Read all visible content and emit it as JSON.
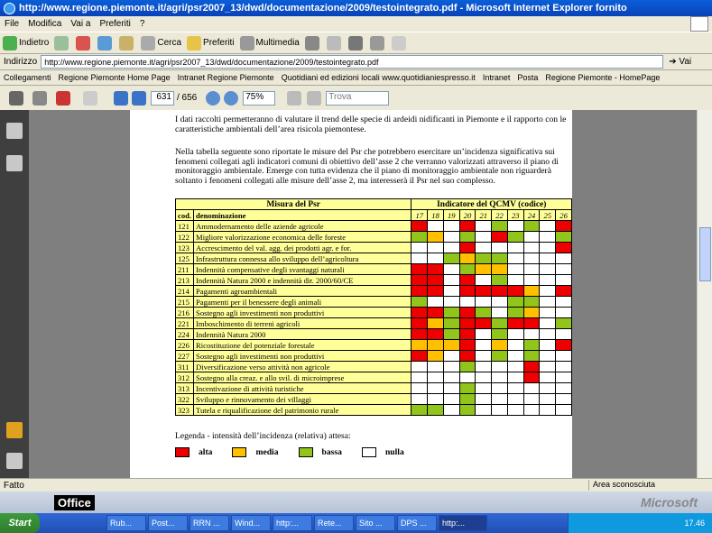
{
  "window": {
    "title": "http://www.regione.piemonte.it/agri/psr2007_13/dwd/documentazione/2009/testointegrato.pdf - Microsoft Internet Explorer fornito"
  },
  "menu": [
    "File",
    "Modifica",
    "Vai a",
    "Preferiti",
    "?"
  ],
  "toolbar": {
    "back": "Indietro",
    "search": "Cerca",
    "favorites": "Preferiti",
    "multimedia": "Multimedia"
  },
  "address": {
    "label": "Indirizzo",
    "url": "http://www.regione.piemonte.it/agri/psr2007_13/dwd/documentazione/2009/testointegrato.pdf",
    "go": "Vai"
  },
  "links": [
    "Collegamenti",
    "Regione Piemonte Home Page",
    "Intranet Regione Piemonte",
    "Quotidiani ed edizioni locali www.quotidianiespresso.it",
    "Intranet",
    "Posta",
    "Regione Piemonte - HomePage"
  ],
  "pdf": {
    "page": "631",
    "total": "/ 656",
    "zoom": "75%",
    "find_placeholder": "Trova"
  },
  "doc": {
    "p1": "I dati raccolti permetteranno di valutare il trend delle specie di ardeidi nidificanti in Piemonte e il rapporto con le caratteristiche ambientali dell’area risicola piemontese.",
    "p2": "Nella tabella seguente sono riportate le misure del Psr che potrebbero esercitare un’incidenza significativa sui fenomeni collegati agli indicatori comuni di obiettivo dell’asse 2 che verranno valorizzati attraverso il piano di monitoraggio ambientale. Emerge con tutta evidenza che il piano di monitoraggio ambientale non riguarderà soltanto i fenomeni collegati alle misure dell’asse 2, ma interesserà il Psr nel suo complesso.",
    "table": {
      "h_misura": "Misura del Psr",
      "h_indicatore": "Indicatore del QCMV (codice)",
      "h_cod": "cod.",
      "h_den": "denominazione",
      "indicators": [
        "17",
        "18",
        "19",
        "20",
        "21",
        "22",
        "23",
        "24",
        "25",
        "26"
      ],
      "rows": [
        {
          "cod": "121",
          "den": "Ammodernamento delle aziende agricole",
          "cells": [
            "r",
            "w",
            "w",
            "r",
            "w",
            "g",
            "w",
            "g",
            "w",
            "r"
          ]
        },
        {
          "cod": "122",
          "den": "Migliore valorizzazione economica delle foreste",
          "cells": [
            "g",
            "y",
            "w",
            "g",
            "w",
            "r",
            "g",
            "w",
            "w",
            "g"
          ]
        },
        {
          "cod": "123",
          "den": "Accrescimento del val. agg. dei prodotti agr. e for.",
          "cells": [
            "w",
            "w",
            "w",
            "r",
            "w",
            "w",
            "w",
            "w",
            "w",
            "r"
          ]
        },
        {
          "cod": "125",
          "den": "Infrastruttura connessa allo sviluppo dell’agricoltura",
          "cells": [
            "w",
            "w",
            "g",
            "y",
            "g",
            "g",
            "w",
            "w",
            "w",
            "w"
          ]
        },
        {
          "cod": "211",
          "den": "Indennità compensative degli svantaggi naturali",
          "cells": [
            "r",
            "r",
            "w",
            "g",
            "y",
            "y",
            "w",
            "w",
            "w",
            "w"
          ]
        },
        {
          "cod": "213",
          "den": "Indennità Natura 2000 e indennità dir. 2000/60/CE",
          "cells": [
            "r",
            "r",
            "w",
            "r",
            "w",
            "g",
            "w",
            "w",
            "w",
            "w"
          ]
        },
        {
          "cod": "214",
          "den": "Pagamenti agroambientali",
          "cells": [
            "r",
            "r",
            "w",
            "r",
            "r",
            "r",
            "r",
            "y",
            "w",
            "r"
          ]
        },
        {
          "cod": "215",
          "den": "Pagamenti per il benessere degli animali",
          "cells": [
            "g",
            "w",
            "w",
            "w",
            "w",
            "w",
            "g",
            "g",
            "w",
            "w"
          ]
        },
        {
          "cod": "216",
          "den": "Sostegno agli investimenti non produttivi",
          "cells": [
            "r",
            "r",
            "g",
            "r",
            "g",
            "w",
            "g",
            "y",
            "w",
            "w"
          ]
        },
        {
          "cod": "221",
          "den": "Imboschimento di terreni agricoli",
          "cells": [
            "r",
            "y",
            "g",
            "r",
            "r",
            "g",
            "r",
            "r",
            "w",
            "g"
          ]
        },
        {
          "cod": "224",
          "den": "Indennità Natura 2000",
          "cells": [
            "r",
            "r",
            "g",
            "r",
            "w",
            "g",
            "w",
            "w",
            "w",
            "w"
          ]
        },
        {
          "cod": "226",
          "den": "Ricostituzione del potenziale forestale",
          "cells": [
            "y",
            "y",
            "y",
            "r",
            "w",
            "y",
            "w",
            "g",
            "w",
            "r"
          ]
        },
        {
          "cod": "227",
          "den": "Sostegno agli investimenti non produttivi",
          "cells": [
            "r",
            "y",
            "w",
            "r",
            "w",
            "g",
            "w",
            "g",
            "w",
            "w"
          ]
        },
        {
          "cod": "311",
          "den": "Diversificazione verso attività non agricole",
          "cells": [
            "w",
            "w",
            "w",
            "g",
            "w",
            "w",
            "w",
            "r",
            "w",
            "w"
          ]
        },
        {
          "cod": "312",
          "den": "Sostegno alla creaz. e allo svil. di microimprese",
          "cells": [
            "w",
            "w",
            "w",
            "w",
            "w",
            "w",
            "w",
            "r",
            "w",
            "w"
          ]
        },
        {
          "cod": "313",
          "den": "Incentivazione di attività turistiche",
          "cells": [
            "w",
            "w",
            "w",
            "g",
            "w",
            "w",
            "w",
            "w",
            "w",
            "w"
          ]
        },
        {
          "cod": "322",
          "den": "Sviluppo e rinnovamento dei villaggi",
          "cells": [
            "w",
            "w",
            "w",
            "g",
            "w",
            "w",
            "w",
            "w",
            "w",
            "w"
          ]
        },
        {
          "cod": "323",
          "den": "Tutela e riqualificazione del patrimonio rurale",
          "cells": [
            "g",
            "g",
            "w",
            "g",
            "w",
            "w",
            "w",
            "w",
            "w",
            "w"
          ]
        }
      ]
    },
    "legend_title": "Legenda - intensità dell’incidenza (relativa) attesa:",
    "legend": [
      {
        "k": "r",
        "label": "alta"
      },
      {
        "k": "y",
        "label": "media"
      },
      {
        "k": "g",
        "label": "bassa"
      },
      {
        "k": "w",
        "label": "nulla"
      }
    ]
  },
  "colors": {
    "r": "#ee0000",
    "y": "#ffc000",
    "g": "#92c51b",
    "w": "#ffffff"
  },
  "status": {
    "left": "Fatto",
    "zone": "Area sconosciuta"
  },
  "office": {
    "label": "Office",
    "brand": "Microsoft"
  },
  "taskbar": {
    "start": "Start",
    "tasks": [
      "Rub...",
      "Post...",
      "RRN ...",
      "Wind...",
      "http:...",
      "Rete...",
      "Sito ...",
      "DPS ...",
      "http:..."
    ],
    "clock": "17.46"
  }
}
